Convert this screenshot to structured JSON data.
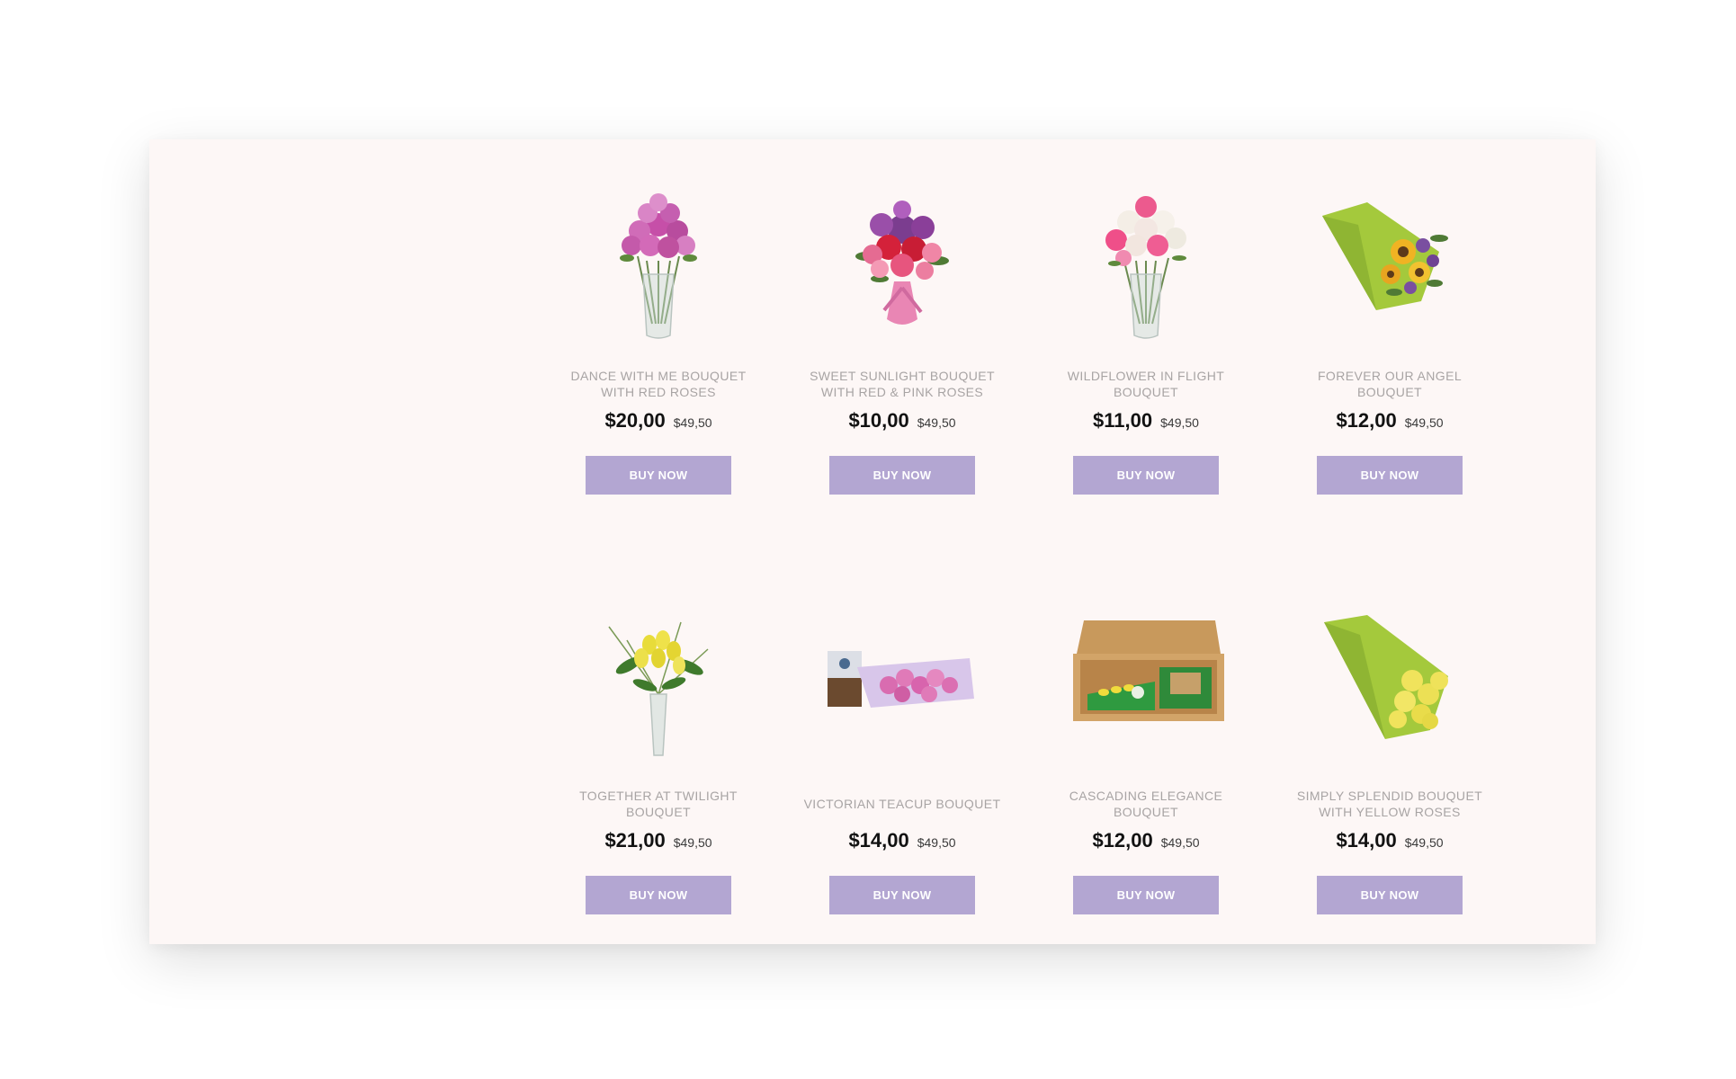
{
  "products": [
    {
      "name": "DANCE WITH ME BOUQUET WITH RED ROSES",
      "price": "$20,00",
      "old_price": "$49,50",
      "button": "BUY NOW",
      "image": "pink-roses-vase"
    },
    {
      "name": "SWEET SUNLIGHT BOUQUET WITH RED & PINK ROSES",
      "price": "$10,00",
      "old_price": "$49,50",
      "button": "BUY NOW",
      "image": "mixed-bouquet-ribbon"
    },
    {
      "name": "WILDFLOWER IN FLIGHT BOUQUET",
      "price": "$11,00",
      "old_price": "$49,50",
      "button": "BUY NOW",
      "image": "pink-white-roses-vase"
    },
    {
      "name": "FOREVER OUR ANGEL BOUQUET",
      "price": "$12,00",
      "old_price": "$49,50",
      "button": "BUY NOW",
      "image": "sunflower-wrapped-bouquet"
    },
    {
      "name": "TOGETHER AT TWILIGHT BOUQUET",
      "price": "$21,00",
      "old_price": "$49,50",
      "button": "BUY NOW",
      "image": "yellow-tulips-vase"
    },
    {
      "name": "VICTORIAN TEACUP BOUQUET",
      "price": "$14,00",
      "old_price": "$49,50",
      "button": "BUY NOW",
      "image": "pink-roses-with-chocolate"
    },
    {
      "name": "CASCADING ELEGANCE BOUQUET",
      "price": "$12,00",
      "old_price": "$49,50",
      "button": "BUY NOW",
      "image": "flower-gift-box"
    },
    {
      "name": "SIMPLY SPLENDID BOUQUET WITH YELLOW ROSES",
      "price": "$14,00",
      "old_price": "$49,50",
      "button": "BUY NOW",
      "image": "yellow-roses-wrapped"
    }
  ],
  "colors": {
    "card_background": "#fdf7f6",
    "button": "#b3a6d2",
    "name_text": "#a8a4a4"
  }
}
